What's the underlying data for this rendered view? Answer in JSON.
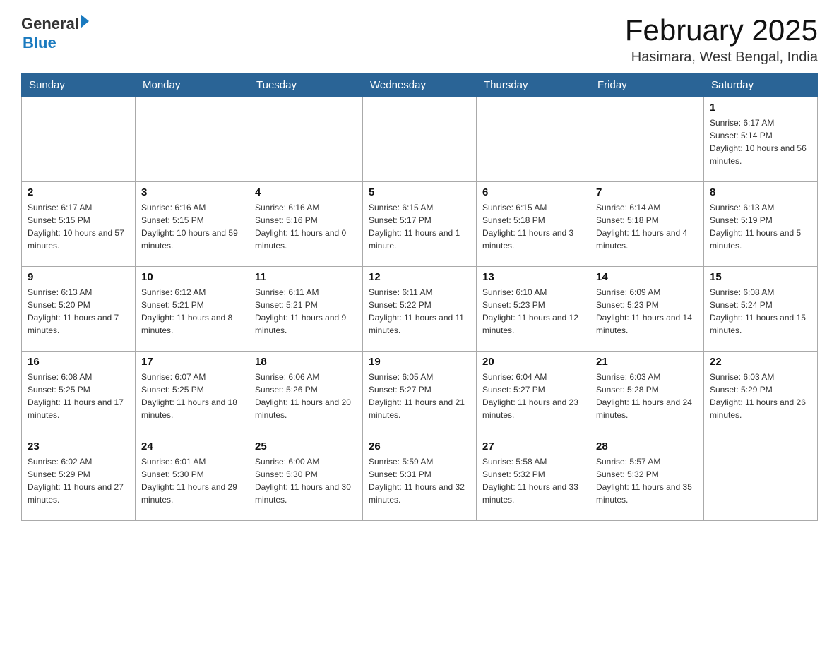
{
  "header": {
    "logo": {
      "text_general": "General",
      "text_blue": "Blue",
      "alt": "GeneralBlue logo"
    },
    "month_title": "February 2025",
    "location": "Hasimara, West Bengal, India"
  },
  "weekdays": [
    "Sunday",
    "Monday",
    "Tuesday",
    "Wednesday",
    "Thursday",
    "Friday",
    "Saturday"
  ],
  "weeks": [
    [
      {
        "day": "",
        "info": ""
      },
      {
        "day": "",
        "info": ""
      },
      {
        "day": "",
        "info": ""
      },
      {
        "day": "",
        "info": ""
      },
      {
        "day": "",
        "info": ""
      },
      {
        "day": "",
        "info": ""
      },
      {
        "day": "1",
        "info": "Sunrise: 6:17 AM\nSunset: 5:14 PM\nDaylight: 10 hours and 56 minutes."
      }
    ],
    [
      {
        "day": "2",
        "info": "Sunrise: 6:17 AM\nSunset: 5:15 PM\nDaylight: 10 hours and 57 minutes."
      },
      {
        "day": "3",
        "info": "Sunrise: 6:16 AM\nSunset: 5:15 PM\nDaylight: 10 hours and 59 minutes."
      },
      {
        "day": "4",
        "info": "Sunrise: 6:16 AM\nSunset: 5:16 PM\nDaylight: 11 hours and 0 minutes."
      },
      {
        "day": "5",
        "info": "Sunrise: 6:15 AM\nSunset: 5:17 PM\nDaylight: 11 hours and 1 minute."
      },
      {
        "day": "6",
        "info": "Sunrise: 6:15 AM\nSunset: 5:18 PM\nDaylight: 11 hours and 3 minutes."
      },
      {
        "day": "7",
        "info": "Sunrise: 6:14 AM\nSunset: 5:18 PM\nDaylight: 11 hours and 4 minutes."
      },
      {
        "day": "8",
        "info": "Sunrise: 6:13 AM\nSunset: 5:19 PM\nDaylight: 11 hours and 5 minutes."
      }
    ],
    [
      {
        "day": "9",
        "info": "Sunrise: 6:13 AM\nSunset: 5:20 PM\nDaylight: 11 hours and 7 minutes."
      },
      {
        "day": "10",
        "info": "Sunrise: 6:12 AM\nSunset: 5:21 PM\nDaylight: 11 hours and 8 minutes."
      },
      {
        "day": "11",
        "info": "Sunrise: 6:11 AM\nSunset: 5:21 PM\nDaylight: 11 hours and 9 minutes."
      },
      {
        "day": "12",
        "info": "Sunrise: 6:11 AM\nSunset: 5:22 PM\nDaylight: 11 hours and 11 minutes."
      },
      {
        "day": "13",
        "info": "Sunrise: 6:10 AM\nSunset: 5:23 PM\nDaylight: 11 hours and 12 minutes."
      },
      {
        "day": "14",
        "info": "Sunrise: 6:09 AM\nSunset: 5:23 PM\nDaylight: 11 hours and 14 minutes."
      },
      {
        "day": "15",
        "info": "Sunrise: 6:08 AM\nSunset: 5:24 PM\nDaylight: 11 hours and 15 minutes."
      }
    ],
    [
      {
        "day": "16",
        "info": "Sunrise: 6:08 AM\nSunset: 5:25 PM\nDaylight: 11 hours and 17 minutes."
      },
      {
        "day": "17",
        "info": "Sunrise: 6:07 AM\nSunset: 5:25 PM\nDaylight: 11 hours and 18 minutes."
      },
      {
        "day": "18",
        "info": "Sunrise: 6:06 AM\nSunset: 5:26 PM\nDaylight: 11 hours and 20 minutes."
      },
      {
        "day": "19",
        "info": "Sunrise: 6:05 AM\nSunset: 5:27 PM\nDaylight: 11 hours and 21 minutes."
      },
      {
        "day": "20",
        "info": "Sunrise: 6:04 AM\nSunset: 5:27 PM\nDaylight: 11 hours and 23 minutes."
      },
      {
        "day": "21",
        "info": "Sunrise: 6:03 AM\nSunset: 5:28 PM\nDaylight: 11 hours and 24 minutes."
      },
      {
        "day": "22",
        "info": "Sunrise: 6:03 AM\nSunset: 5:29 PM\nDaylight: 11 hours and 26 minutes."
      }
    ],
    [
      {
        "day": "23",
        "info": "Sunrise: 6:02 AM\nSunset: 5:29 PM\nDaylight: 11 hours and 27 minutes."
      },
      {
        "day": "24",
        "info": "Sunrise: 6:01 AM\nSunset: 5:30 PM\nDaylight: 11 hours and 29 minutes."
      },
      {
        "day": "25",
        "info": "Sunrise: 6:00 AM\nSunset: 5:30 PM\nDaylight: 11 hours and 30 minutes."
      },
      {
        "day": "26",
        "info": "Sunrise: 5:59 AM\nSunset: 5:31 PM\nDaylight: 11 hours and 32 minutes."
      },
      {
        "day": "27",
        "info": "Sunrise: 5:58 AM\nSunset: 5:32 PM\nDaylight: 11 hours and 33 minutes."
      },
      {
        "day": "28",
        "info": "Sunrise: 5:57 AM\nSunset: 5:32 PM\nDaylight: 11 hours and 35 minutes."
      },
      {
        "day": "",
        "info": ""
      }
    ]
  ]
}
